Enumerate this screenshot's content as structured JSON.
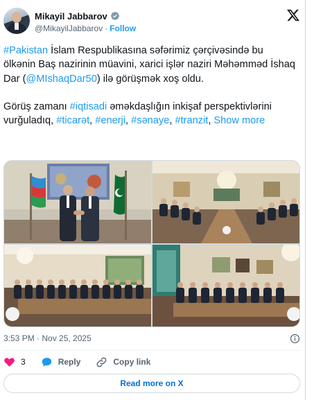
{
  "author": {
    "name": "Mikayil Jabbarov",
    "handle": "@MikayilJabbarov",
    "separator": "·",
    "follow_label": "Follow"
  },
  "post": {
    "p1": [
      {
        "t": "#Pakistan",
        "k": "tag"
      },
      {
        "t": " İslam Respublikasına səfərimiz çərçivəsində bu ölkənin Baş nazirinin müavini, xarici işlər naziri Məhəmməd İshaq Dar (",
        "k": "text"
      },
      {
        "t": "@MIshaqDar50",
        "k": "mention"
      },
      {
        "t": ") ilə görüşmək xoş oldu.",
        "k": "text"
      }
    ],
    "p2": [
      {
        "t": "Görüş zamanı ",
        "k": "text"
      },
      {
        "t": "#iqtisadi",
        "k": "tag"
      },
      {
        "t": " əməkdaşlığın inkişaf perspektivlərini vurğuladıq, ",
        "k": "text"
      },
      {
        "t": "#ticarət",
        "k": "tag"
      },
      {
        "t": ", ",
        "k": "text"
      },
      {
        "t": "#enerji",
        "k": "tag"
      },
      {
        "t": ", ",
        "k": "text"
      },
      {
        "t": "#sənaye",
        "k": "tag"
      },
      {
        "t": ", ",
        "k": "text"
      },
      {
        "t": "#tranzit",
        "k": "tag"
      },
      {
        "t": ", ",
        "k": "text"
      }
    ],
    "show_more": "Show more",
    "timestamp": "3:53 PM · Nov 25, 2025"
  },
  "actions": {
    "like_count": "3",
    "reply_label": "Reply",
    "copy_link_label": "Copy link"
  },
  "read_more_label": "Read more on X",
  "colors": {
    "accent": "#1d9bf0",
    "like": "#f91880",
    "text": "#0f1419",
    "muted": "#536471"
  },
  "icons": [
    "verified-badge-icon",
    "x-logo-icon",
    "info-icon",
    "heart-icon",
    "reply-bubble-icon",
    "link-icon"
  ]
}
